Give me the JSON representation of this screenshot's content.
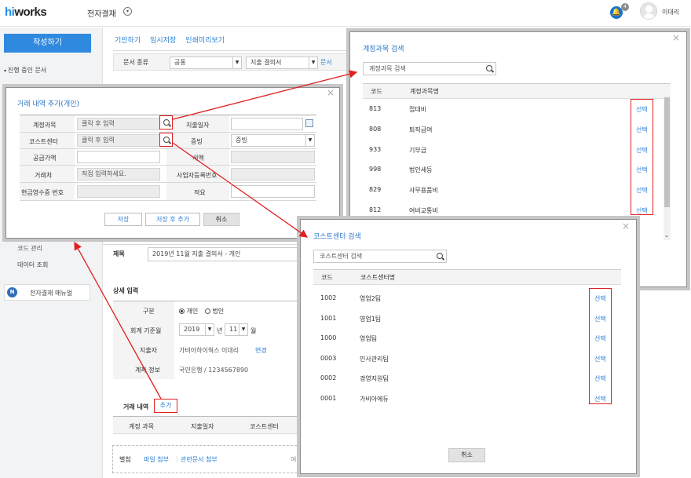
{
  "header": {
    "logo_hi": "hi",
    "logo_rest": "works",
    "app_title": "전자결재",
    "notification_count": "4",
    "user_name": "이대리"
  },
  "sidebar": {
    "compose_label": "작성하기",
    "in_progress_label": "진행 중인 문서",
    "code_mgmt_label": "코드 관리",
    "data_view_label": "데이터 조회",
    "manual_label": "전자결재 매뉴얼",
    "manual_icon": "N"
  },
  "main": {
    "tabs": [
      "기안하기",
      "임시저장",
      "인쇄미리보기"
    ],
    "doc_type_label": "문서 종류",
    "doc_type_value1": "공통",
    "doc_type_value2": "지출 결의서",
    "doc_type_link": "문서",
    "subject_label": "제목",
    "subject_value": "2019년 11월 지출 결의서 - 개인",
    "detail_title": "상세 입력",
    "category_label": "구분",
    "category_options": [
      "개인",
      "법인"
    ],
    "accounting_month_label": "회계 기준월",
    "year_value": "2019",
    "year_unit": "년",
    "month_value": "11",
    "month_unit": "월",
    "spender_label": "지출자",
    "spender_value": "가비아하이웍스 이대리",
    "spender_change": "변경",
    "account_info_label": "계좌 정보",
    "account_info_value": "국민은행 / 1234567890",
    "transactions_label": "거래 내역",
    "transactions_add": "추가",
    "transactions_columns": [
      "계정 과목",
      "지출일자",
      "코스트센터"
    ],
    "attachment_label": "별첨",
    "attach_file": "파일 첨부",
    "attach_doc": "관련문서 첨부",
    "attach_more": "여"
  },
  "txn_modal": {
    "title": "거래 내역 추가(개인)",
    "account_label": "계정과목",
    "account_placeholder": "클릭 후 입력",
    "date_label": "지출일자",
    "cost_center_label": "코스트센터",
    "cost_center_placeholder": "클릭 후 입력",
    "evidence_label": "증빙",
    "evidence_value": "증빙",
    "supply_label": "공급가액",
    "tax_label": "세액",
    "vendor_label": "거래처",
    "vendor_placeholder": "직접 입력하세요.",
    "biz_no_label": "사업자등록번호",
    "receipt_no_label": "현금영수증 번호",
    "memo_label": "적요",
    "save_label": "저장",
    "save_add_label": "저장 후 추가",
    "cancel_label": "취소"
  },
  "account_modal": {
    "title": "계정과목 검색",
    "search_placeholder": "계정과목 검색",
    "col_code": "코드",
    "col_name": "계정과목명",
    "select_label": "선택",
    "rows": [
      {
        "code": "813",
        "name": "접대비"
      },
      {
        "code": "808",
        "name": "퇴직급여"
      },
      {
        "code": "933",
        "name": "기부금"
      },
      {
        "code": "998",
        "name": "법인세등"
      },
      {
        "code": "829",
        "name": "사무용품비"
      },
      {
        "code": "812",
        "name": "여비교통비"
      }
    ]
  },
  "cost_modal": {
    "title": "코스트센터 검색",
    "search_placeholder": "코스트센터 검색",
    "col_code": "코드",
    "col_name": "코스트센터명",
    "select_label": "선택",
    "rows": [
      {
        "code": "1002",
        "name": "영업2팀"
      },
      {
        "code": "1001",
        "name": "영업1팀"
      },
      {
        "code": "1000",
        "name": "영업팀"
      },
      {
        "code": "0003",
        "name": "인사관리팀"
      },
      {
        "code": "0002",
        "name": "경영지원팀"
      },
      {
        "code": "0001",
        "name": "가비아에듀"
      }
    ],
    "cancel_label": "취소"
  },
  "colors": {
    "accent": "#2f89df",
    "link": "#2a7fd4",
    "highlight_red": "#e02020"
  }
}
